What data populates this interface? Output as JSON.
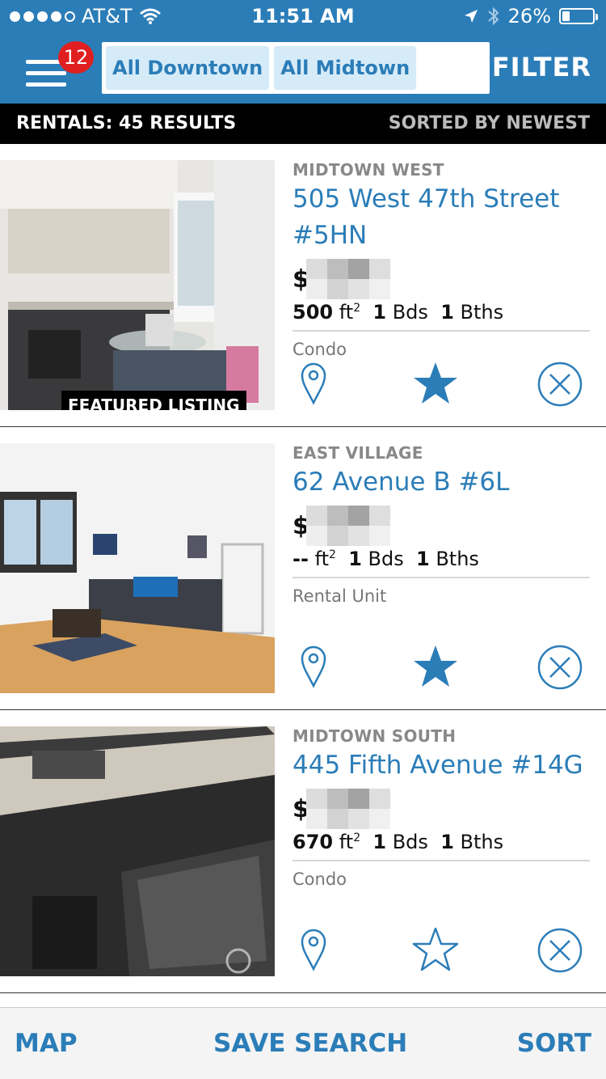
{
  "status_bar": {
    "carrier": "AT&T",
    "time": "11:51 AM",
    "battery": "26%",
    "battery_level": 0.26
  },
  "header": {
    "notification_count": "12",
    "chips": [
      "All Downtown",
      "All Midtown"
    ],
    "filter_label": "FILTER"
  },
  "results": {
    "count_label": "RENTALS: 45 RESULTS",
    "sort_label": "SORTED BY NEWEST"
  },
  "listings": [
    {
      "neighborhood": "MIDTOWN WEST",
      "address_line1": "505 West 47th Street",
      "address_line2": "#5HN",
      "price_prefix": "$",
      "sqft": "500",
      "sqft_unit": "ft",
      "beds": "1",
      "beds_label": "Bds",
      "baths": "1",
      "baths_label": "Bths",
      "type": "Condo",
      "featured_label": "FEATURED LISTING",
      "favorited": true
    },
    {
      "neighborhood": "EAST VILLAGE",
      "address_line1": "62 Avenue B #6L",
      "price_prefix": "$",
      "sqft": "--",
      "sqft_unit": "ft",
      "beds": "1",
      "beds_label": "Bds",
      "baths": "1",
      "baths_label": "Bths",
      "type": "Rental Unit",
      "favorited": true
    },
    {
      "neighborhood": "MIDTOWN SOUTH",
      "address_line1": "445 Fifth Avenue #14G",
      "price_prefix": "$",
      "sqft": "670",
      "sqft_unit": "ft",
      "beds": "1",
      "beds_label": "Bds",
      "baths": "1",
      "baths_label": "Bths",
      "type": "Condo",
      "favorited": false
    }
  ],
  "bottom_bar": {
    "map": "MAP",
    "save_search": "SAVE SEARCH",
    "sort": "SORT"
  },
  "colors": {
    "brand_blue": "#2b7db8",
    "badge_red": "#e02020"
  },
  "icons": [
    "signal-dots-icon",
    "wifi-icon",
    "location-arrow-icon",
    "bluetooth-icon",
    "battery-icon",
    "menu-icon",
    "map-pin-icon",
    "star-icon",
    "close-circle-icon"
  ]
}
